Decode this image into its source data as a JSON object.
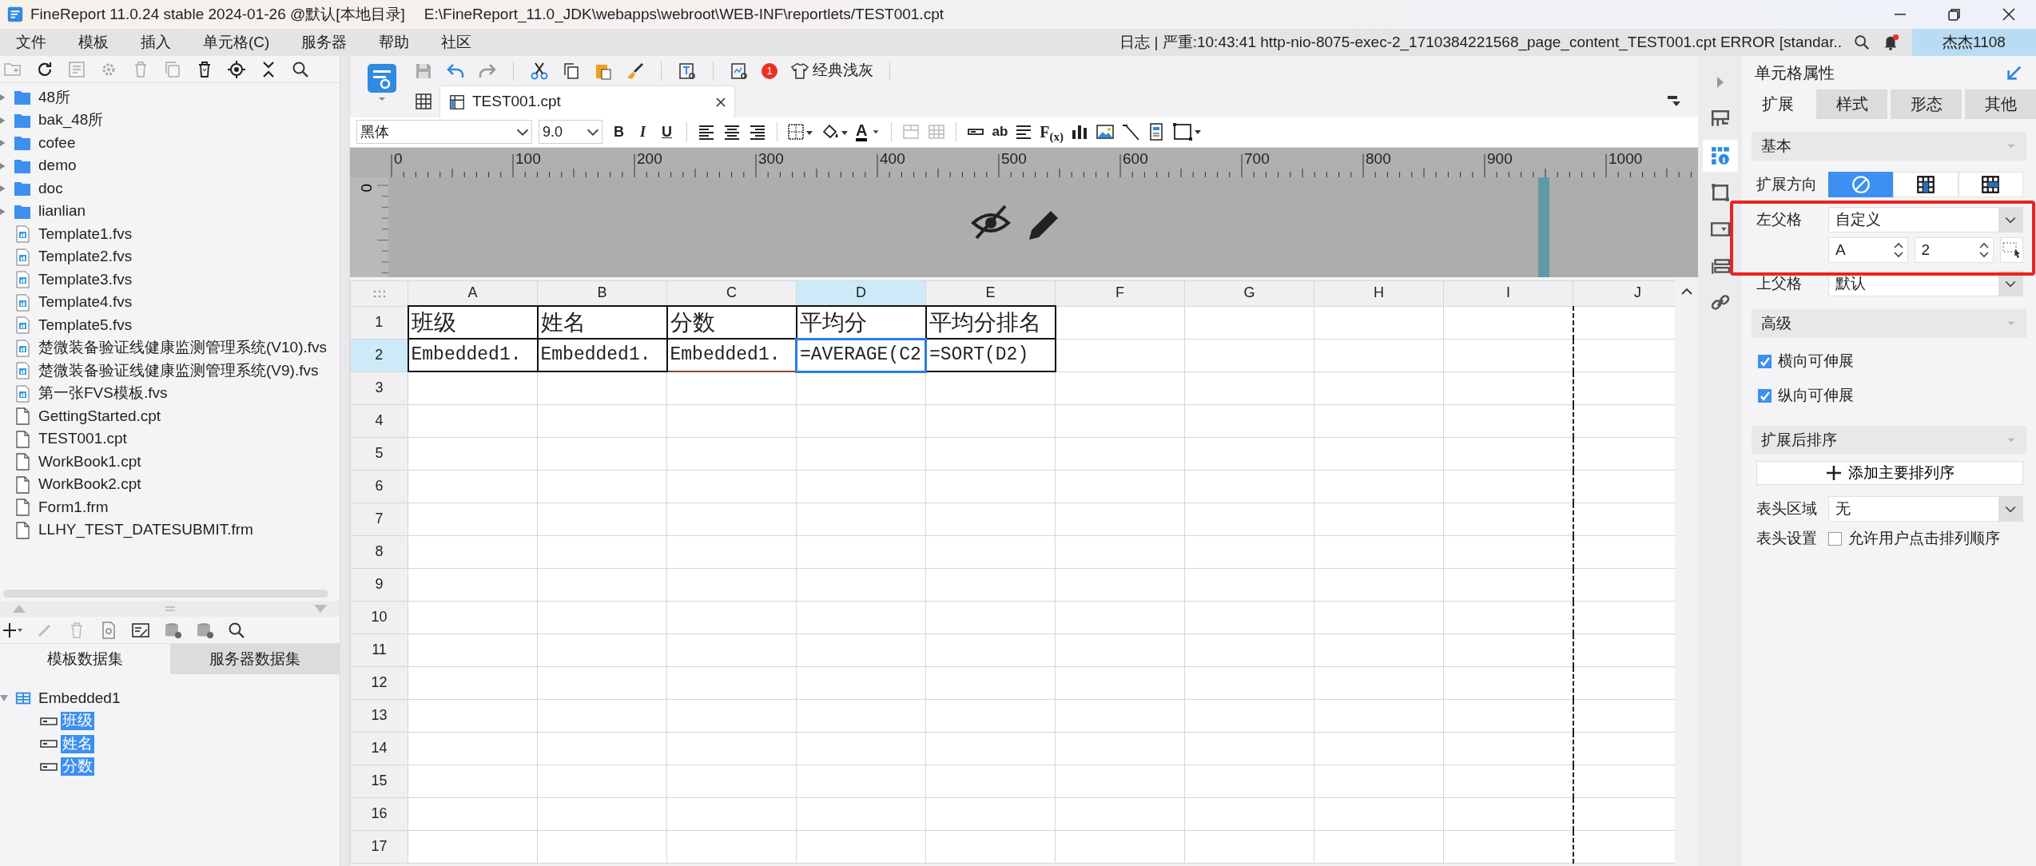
{
  "window": {
    "title": "FineReport 11.0.24 stable 2024-01-26 @默认[本地目录]",
    "path": "E:\\FineReport_11.0_JDK\\webapps\\webroot\\WEB-INF\\reportlets/TEST001.cpt"
  },
  "menu": [
    "文件",
    "模板",
    "插入",
    "单元格(C)",
    "服务器",
    "帮助",
    "社区"
  ],
  "log": "日志 | 严重:10:43:41 http-nio-8075-exec-2_1710384221568_page_content_TEST001.cpt ERROR [standar..",
  "notifications": {
    "unread": true
  },
  "user": "杰杰1108",
  "files": [
    {
      "name": "48所",
      "kind": "folder"
    },
    {
      "name": "bak_48所",
      "kind": "folder"
    },
    {
      "name": "cofee",
      "kind": "folder"
    },
    {
      "name": "demo",
      "kind": "folder"
    },
    {
      "name": "doc",
      "kind": "folder"
    },
    {
      "name": "lianlian",
      "kind": "folder"
    },
    {
      "name": "Template1.fvs",
      "kind": "dashboard"
    },
    {
      "name": "Template2.fvs",
      "kind": "dashboard"
    },
    {
      "name": "Template3.fvs",
      "kind": "dashboard"
    },
    {
      "name": "Template4.fvs",
      "kind": "dashboard"
    },
    {
      "name": "Template5.fvs",
      "kind": "dashboard"
    },
    {
      "name": "楚微装备验证线健康监测管理系统(V10).fvs",
      "kind": "dashboard"
    },
    {
      "name": "楚微装备验证线健康监测管理系统(V9).fvs",
      "kind": "dashboard"
    },
    {
      "name": "第一张FVS模板.fvs",
      "kind": "dashboard"
    },
    {
      "name": "GettingStarted.cpt",
      "kind": "file"
    },
    {
      "name": "TEST001.cpt",
      "kind": "file"
    },
    {
      "name": "WorkBook1.cpt",
      "kind": "file"
    },
    {
      "name": "WorkBook2.cpt",
      "kind": "file"
    },
    {
      "name": "Form1.frm",
      "kind": "file"
    },
    {
      "name": "LLHY_TEST_DATESUBMIT.frm",
      "kind": "file"
    }
  ],
  "dataset_tabs": [
    {
      "label": "模板数据集",
      "selected": true
    },
    {
      "label": "服务器数据集",
      "selected": false
    }
  ],
  "datasets": [
    {
      "name": "Embedded1",
      "children": [
        {
          "name": "班级",
          "selected": true
        },
        {
          "name": "姓名",
          "selected": true
        },
        {
          "name": "分数",
          "selected": true
        }
      ]
    }
  ],
  "toolbar": {
    "badge": "1",
    "theme": "经典浅灰"
  },
  "document_tabs": [
    {
      "label": "TEST001.cpt",
      "selected": true
    }
  ],
  "format": {
    "font": "黑体",
    "size": "9.0",
    "styles": [
      "B",
      "I",
      "U"
    ],
    "color_letter": "A",
    "tools": [
      "ab",
      "F$_{(x)}$"
    ]
  },
  "ruler": {
    "labels": [
      "0",
      "100",
      "200",
      "300",
      "400",
      "500",
      "600",
      "700",
      "800",
      "900",
      "1000"
    ],
    "vertical_label": "0"
  },
  "sheet": {
    "columns": [
      {
        "label": "A",
        "selected": false,
        "page_break_after": false
      },
      {
        "label": "B",
        "selected": false,
        "page_break_after": false
      },
      {
        "label": "C",
        "selected": false,
        "page_break_after": false
      },
      {
        "label": "D",
        "selected": true,
        "page_break_after": false
      },
      {
        "label": "E",
        "selected": false,
        "page_break_after": false
      },
      {
        "label": "F",
        "selected": false,
        "page_break_after": false
      },
      {
        "label": "G",
        "selected": false,
        "page_break_after": false
      },
      {
        "label": "H",
        "selected": false,
        "page_break_after": false
      },
      {
        "label": "I",
        "selected": false,
        "page_break_after": true
      },
      {
        "label": "J",
        "selected": false,
        "page_break_after": false
      }
    ],
    "rows": [
      {
        "label": "1",
        "selected": false,
        "cells": [
          {
            "text": "班级",
            "selected": false,
            "outlined": false
          },
          {
            "text": "姓名",
            "selected": false,
            "outlined": false
          },
          {
            "text": "分数",
            "selected": false,
            "outlined": false
          },
          {
            "text": "平均分",
            "selected": false,
            "outlined": false
          },
          {
            "text": "平均分排名",
            "selected": false,
            "outlined": false
          }
        ]
      },
      {
        "label": "2",
        "selected": true,
        "cells": [
          {
            "text": "Embedded1.",
            "selected": false,
            "outlined": false
          },
          {
            "text": "Embedded1.",
            "selected": false,
            "outlined": false
          },
          {
            "text": "Embedded1.",
            "selected": false,
            "outlined": true
          },
          {
            "text": "=AVERAGE(C2",
            "selected": true,
            "outlined": false
          },
          {
            "text": "=SORT(D2)",
            "selected": false,
            "outlined": false
          }
        ]
      },
      {
        "label": "3",
        "selected": false
      },
      {
        "label": "4",
        "selected": false
      },
      {
        "label": "5",
        "selected": false
      },
      {
        "label": "6",
        "selected": false
      },
      {
        "label": "7",
        "selected": false
      },
      {
        "label": "8",
        "selected": false
      },
      {
        "label": "9",
        "selected": false
      },
      {
        "label": "10",
        "selected": false
      },
      {
        "label": "11",
        "selected": false
      },
      {
        "label": "12",
        "selected": false
      },
      {
        "label": "13",
        "selected": false
      },
      {
        "label": "14",
        "selected": false
      },
      {
        "label": "15",
        "selected": false
      },
      {
        "label": "16",
        "selected": false
      },
      {
        "label": "17",
        "selected": false
      }
    ]
  },
  "side_tabs": [
    {
      "kind": "layout",
      "selected": false
    },
    {
      "kind": "cell",
      "selected": true
    },
    {
      "kind": "border",
      "selected": false
    },
    {
      "kind": "widget",
      "selected": false
    },
    {
      "kind": "condition",
      "selected": false
    },
    {
      "kind": "link",
      "selected": false
    }
  ],
  "properties": {
    "title": "单元格属性",
    "tabs": [
      {
        "label": "扩展",
        "selected": true
      },
      {
        "label": "样式",
        "selected": false
      },
      {
        "label": "形态",
        "selected": false
      },
      {
        "label": "其他",
        "selected": false
      }
    ],
    "basic": {
      "heading": "基本",
      "direction": {
        "label": "扩展方向",
        "options": [
          {
            "kind": "none",
            "selected": true
          },
          {
            "kind": "vertical",
            "selected": false
          },
          {
            "kind": "horizontal",
            "selected": false
          }
        ]
      },
      "left_parent": {
        "label": "左父格",
        "value": "自定义",
        "column": "A",
        "row": "2",
        "highlighted": true
      },
      "top_parent": {
        "label": "上父格",
        "value": "默认"
      }
    },
    "advanced": {
      "heading": "高级",
      "options": [
        {
          "label": "横向可伸展",
          "checked": true
        },
        {
          "label": "纵向可伸展",
          "checked": true
        }
      ]
    },
    "sorting": {
      "heading": "扩展后排序",
      "button": "添加主要排列序",
      "header_area": {
        "label": "表头区域",
        "value": "无"
      },
      "header_setting": {
        "label": "表头设置",
        "option": "允许用户点击排列顺序",
        "checked": false
      }
    }
  }
}
